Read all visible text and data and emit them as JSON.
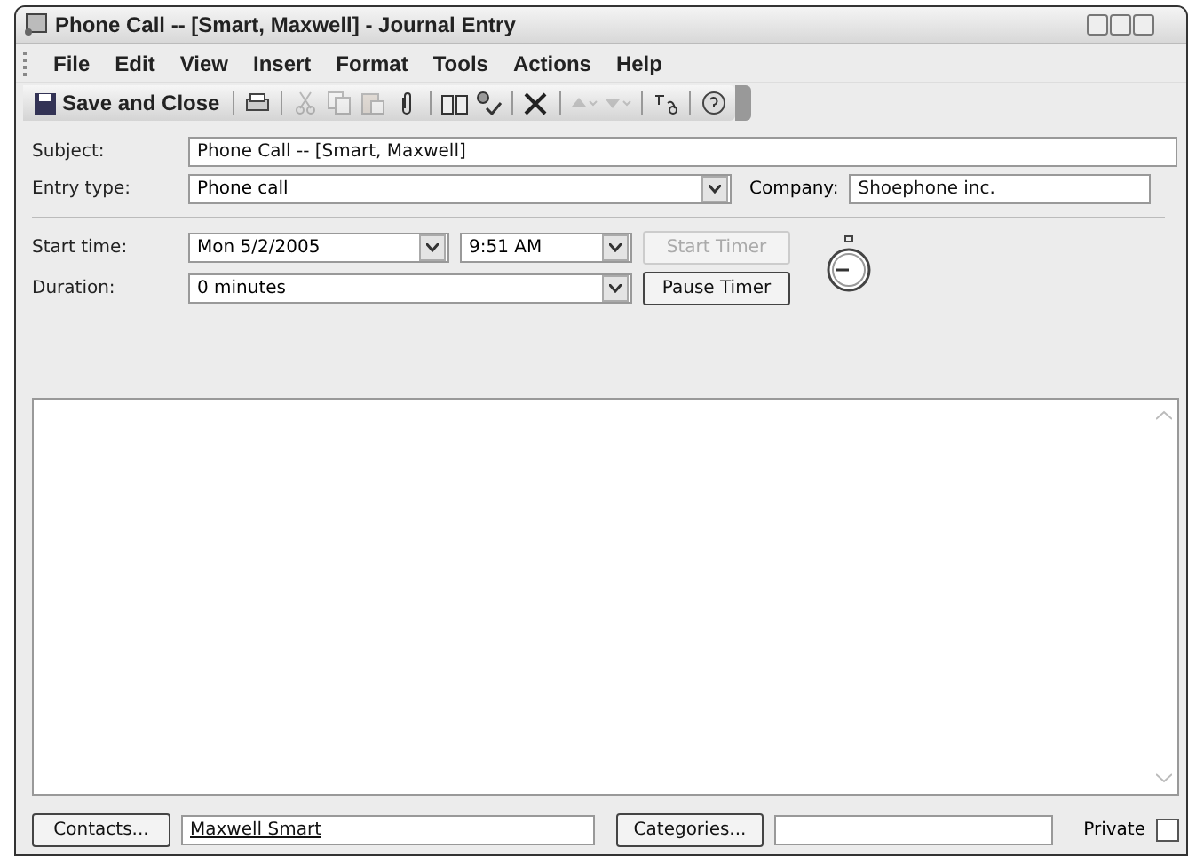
{
  "window": {
    "title": "Phone Call -- [Smart, Maxwell] - Journal Entry"
  },
  "menu": [
    "File",
    "Edit",
    "View",
    "Insert",
    "Format",
    "Tools",
    "Actions",
    "Help"
  ],
  "toolbar": [
    {
      "kind": "save",
      "label": "Save and Close",
      "disabled": false
    },
    {
      "kind": "sep"
    },
    {
      "kind": "print",
      "disabled": false
    },
    {
      "kind": "sep"
    },
    {
      "kind": "cut",
      "disabled": true
    },
    {
      "kind": "copy",
      "disabled": true
    },
    {
      "kind": "paste",
      "disabled": true
    },
    {
      "kind": "attach",
      "disabled": false
    },
    {
      "kind": "sep"
    },
    {
      "kind": "book",
      "disabled": false
    },
    {
      "kind": "check",
      "disabled": false
    },
    {
      "kind": "sep"
    },
    {
      "kind": "delete",
      "disabled": false
    },
    {
      "kind": "sep"
    },
    {
      "kind": "up",
      "disabled": true
    },
    {
      "kind": "down",
      "disabled": true
    },
    {
      "kind": "sep"
    },
    {
      "kind": "translate",
      "disabled": false
    },
    {
      "kind": "sep"
    },
    {
      "kind": "help",
      "disabled": false
    }
  ],
  "subject": {
    "label": "Subject:",
    "value": "Phone Call -- [Smart, Maxwell]"
  },
  "entry_type": {
    "label": "Entry type:",
    "value": "Phone call"
  },
  "company": {
    "label": "Company:",
    "value": "Shoephone inc."
  },
  "start_time": {
    "label": "Start time:",
    "date": "Mon 5/2/2005",
    "time": "9:51 AM"
  },
  "duration": {
    "label": "Duration:",
    "value": "0 minutes"
  },
  "timer_buttons": [
    {
      "label": "Start Timer",
      "disabled": true
    },
    {
      "label": "Pause Timer",
      "disabled": false
    }
  ],
  "footer": {
    "contacts_button": "Contacts...",
    "contacts_value": "Maxwell Smart",
    "categories_button": "Categories...",
    "private_label": "Private",
    "private_checked": false
  }
}
